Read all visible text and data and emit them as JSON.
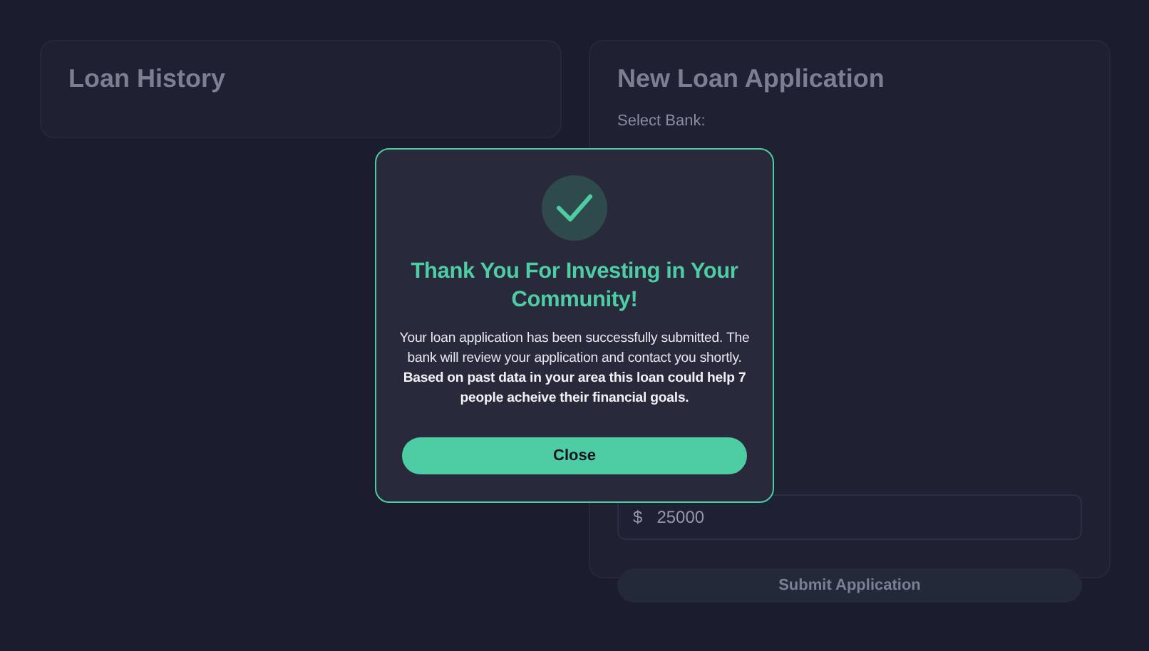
{
  "loan_history": {
    "title": "Loan History"
  },
  "application": {
    "title": "New Loan Application",
    "bank_label": "Select Bank:",
    "amount": {
      "prefix": "$",
      "value": "25000"
    },
    "submit": "Submit Application"
  },
  "modal": {
    "title": "Thank You For Investing in Your Community!",
    "message": "Your loan application has been successfully submitted. The bank will review your application and contact you shortly. **Based on past data in your area this loan could help 7 people acheive their financial goals.**",
    "button": "Close"
  }
}
